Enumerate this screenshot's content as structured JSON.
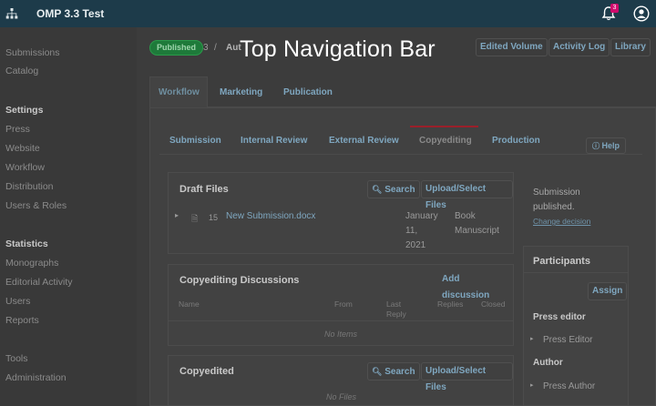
{
  "app": {
    "title": "OMP 3.3 Test",
    "notification_count": "3"
  },
  "overlay": {
    "label": "Top Navigation Bar"
  },
  "sidebar": {
    "items": [
      {
        "label": "Submissions"
      },
      {
        "label": "Catalog"
      }
    ],
    "settings_heading": "Settings",
    "settings_items": [
      {
        "label": "Press"
      },
      {
        "label": "Website"
      },
      {
        "label": "Workflow"
      },
      {
        "label": "Distribution"
      },
      {
        "label": "Users & Roles"
      }
    ],
    "statistics_heading": "Statistics",
    "statistics_items": [
      {
        "label": "Monographs"
      },
      {
        "label": "Editorial Activity"
      },
      {
        "label": "Users"
      },
      {
        "label": "Reports"
      }
    ],
    "bottom_items": [
      {
        "label": "Tools"
      },
      {
        "label": "Administration"
      }
    ]
  },
  "header": {
    "status": "Published",
    "submission_id": "3",
    "separator": "/",
    "author_truncated": "Aut",
    "buttons": [
      {
        "label": "Edited Volume"
      },
      {
        "label": "Activity Log"
      },
      {
        "label": "Library"
      }
    ]
  },
  "tabs": [
    {
      "label": "Workflow"
    },
    {
      "label": "Marketing"
    },
    {
      "label": "Publication"
    }
  ],
  "stages": [
    {
      "label": "Submission"
    },
    {
      "label": "Internal Review"
    },
    {
      "label": "External Review"
    },
    {
      "label": "Copyediting"
    },
    {
      "label": "Production"
    }
  ],
  "help_label": "Help",
  "draft_files": {
    "title": "Draft Files",
    "search_label": "Search",
    "upload_label": "Upload/Select Files",
    "file": {
      "id": "15",
      "name": "New Submission.docx",
      "date_line1": "January",
      "date_line2": "11,",
      "date_line3": "2021",
      "type_line1": "Book",
      "type_line2": "Manuscript"
    }
  },
  "discussions": {
    "title": "Copyediting Discussions",
    "add_label": "Add discussion",
    "columns": {
      "name": "Name",
      "from": "From",
      "last_reply_1": "Last",
      "last_reply_2": "Reply",
      "replies": "Replies",
      "closed": "Closed"
    },
    "empty": "No Items"
  },
  "copyedited": {
    "title": "Copyedited",
    "search_label": "Search",
    "upload_label": "Upload/Select Files",
    "empty": "No Files"
  },
  "side": {
    "status_line1": "Submission",
    "status_line2": "published.",
    "change_decision": "Change decision",
    "participants_heading": "Participants",
    "assign_label": "Assign",
    "press_editor_heading": "Press editor",
    "press_editor_name": "Press Editor",
    "author_heading": "Author",
    "author_name": "Press Author"
  }
}
